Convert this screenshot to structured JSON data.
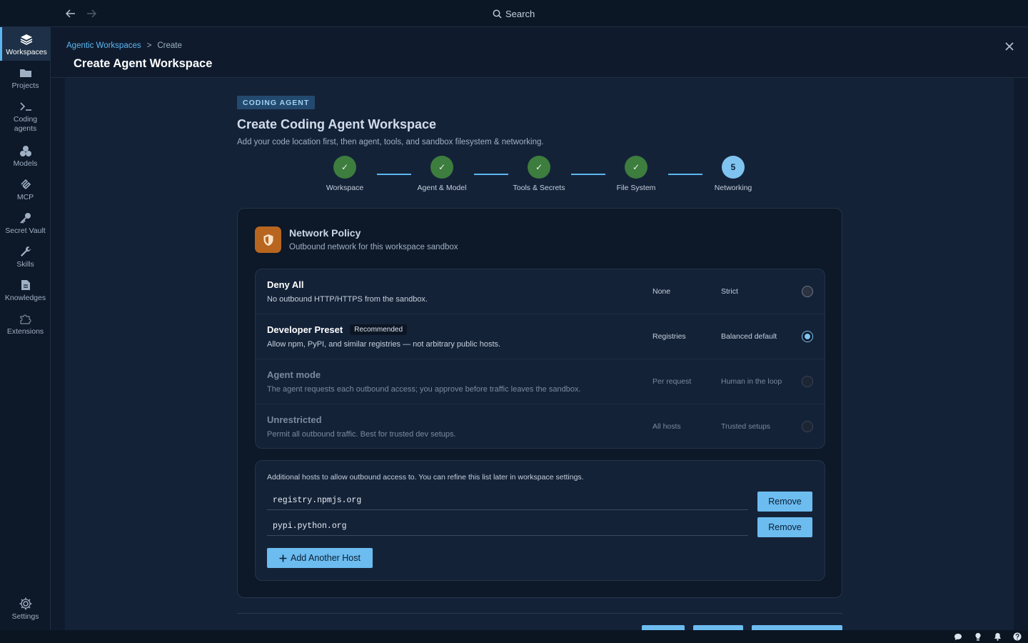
{
  "topbar": {
    "search_label": "Search",
    "back_icon": "arrow-left-icon",
    "forward_icon": "arrow-right-icon"
  },
  "sidebar": {
    "items": [
      {
        "label": "Workspaces",
        "icon": "layers-icon",
        "active": true
      },
      {
        "label": "Projects",
        "icon": "folder-icon"
      },
      {
        "label": "Coding agents",
        "icon": "terminal-icon"
      },
      {
        "label": "Models",
        "icon": "cubes-icon"
      },
      {
        "label": "MCP",
        "icon": "mcp-icon"
      },
      {
        "label": "Secret Vault",
        "icon": "key-icon"
      },
      {
        "label": "Skills",
        "icon": "wrench-icon"
      },
      {
        "label": "Knowledges",
        "icon": "document-icon"
      },
      {
        "label": "Extensions",
        "icon": "puzzle-icon"
      }
    ],
    "settings_label": "Settings"
  },
  "header": {
    "breadcrumb_link": "Agentic Workspaces",
    "breadcrumb_sep": ">",
    "breadcrumb_current": "Create",
    "title": "Create Agent Workspace"
  },
  "main": {
    "badge": "CODING AGENT",
    "title": "Create Coding Agent Workspace",
    "subtitle": "Add your code location first, then agent, tools, and sandbox filesystem & networking."
  },
  "stepper": {
    "steps": [
      {
        "label": "Workspace",
        "mark": "✓",
        "state": "done"
      },
      {
        "label": "Agent & Model",
        "mark": "✓",
        "state": "done"
      },
      {
        "label": "Tools & Secrets",
        "mark": "✓",
        "state": "done"
      },
      {
        "label": "File System",
        "mark": "✓",
        "state": "done"
      },
      {
        "label": "Networking",
        "mark": "5",
        "state": "current"
      }
    ]
  },
  "policy": {
    "title": "Network Policy",
    "subtitle": "Outbound network for this workspace sandbox",
    "options": [
      {
        "name": "Deny All",
        "desc": "No outbound HTTP/HTTPS from the sandbox.",
        "scope": "None",
        "mode": "Strict",
        "selected": false
      },
      {
        "name": "Developer Preset",
        "tag": "Recommended",
        "desc": "Allow npm, PyPI, and similar registries — not arbitrary public hosts.",
        "scope": "Registries",
        "mode": "Balanced default",
        "selected": true
      },
      {
        "name": "Agent mode",
        "desc": "The agent requests each outbound access; you approve before traffic leaves the sandbox.",
        "scope": "Per request",
        "mode": "Human in the loop",
        "selected": false
      },
      {
        "name": "Unrestricted",
        "desc": "Permit all outbound traffic. Best for trusted dev setups.",
        "scope": "All hosts",
        "mode": "Trusted setups",
        "selected": false
      }
    ]
  },
  "hosts": {
    "note": "Additional hosts to allow outbound access to. You can refine this list later in workspace settings.",
    "items": [
      "registry.npmjs.org",
      "pypi.python.org"
    ],
    "remove_label": "Remove",
    "add_label": "Add Another Host"
  },
  "colors": {
    "accent": "#6cbcf0",
    "success": "#3d7d3e",
    "policy_icon_bg": "#b8651f"
  }
}
